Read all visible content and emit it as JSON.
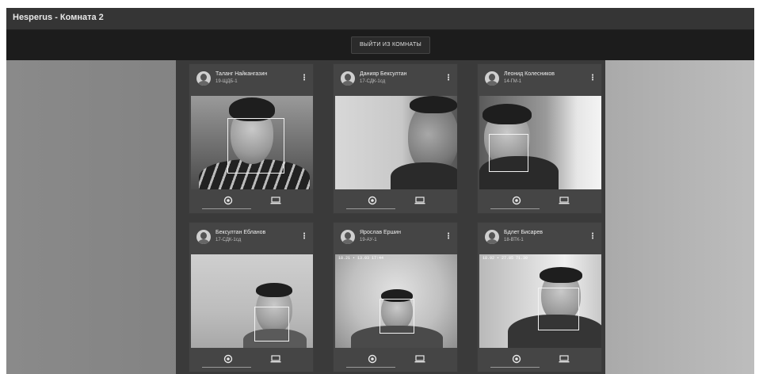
{
  "window": {
    "title": "Hesperus - Комната 2"
  },
  "toolbar": {
    "exit_label": "ВЫЙТИ ИЗ КОМНАТЫ"
  },
  "participants": [
    {
      "name": "Таланг Найкангазин",
      "group": "19-ЩДБ-1",
      "overlay": ""
    },
    {
      "name": "Данияр Бексултан",
      "group": "17-СДК-1сд",
      "overlay": ""
    },
    {
      "name": "Леонид Колесников",
      "group": "14-ГМ-1",
      "overlay": ""
    },
    {
      "name": "Бексултан Ебланов",
      "group": "17-СДК-1сд",
      "overlay": ""
    },
    {
      "name": "Ярослав Ершин",
      "group": "19-АУ-1",
      "overlay": "18.21 • 13.03 17:44"
    },
    {
      "name": "Бдлет Бисарев",
      "group": "18-ВТК-1",
      "overlay": "18.92 • 27.85 71.30"
    }
  ],
  "icons": {
    "menu": "kebab-menu-icon",
    "mic": "camera-toggle-icon",
    "screen": "screen-share-icon"
  },
  "colors": {
    "window_bg": "#2a2a2a",
    "topbar_bg": "#1c1c1c",
    "card_bg": "#454545"
  }
}
